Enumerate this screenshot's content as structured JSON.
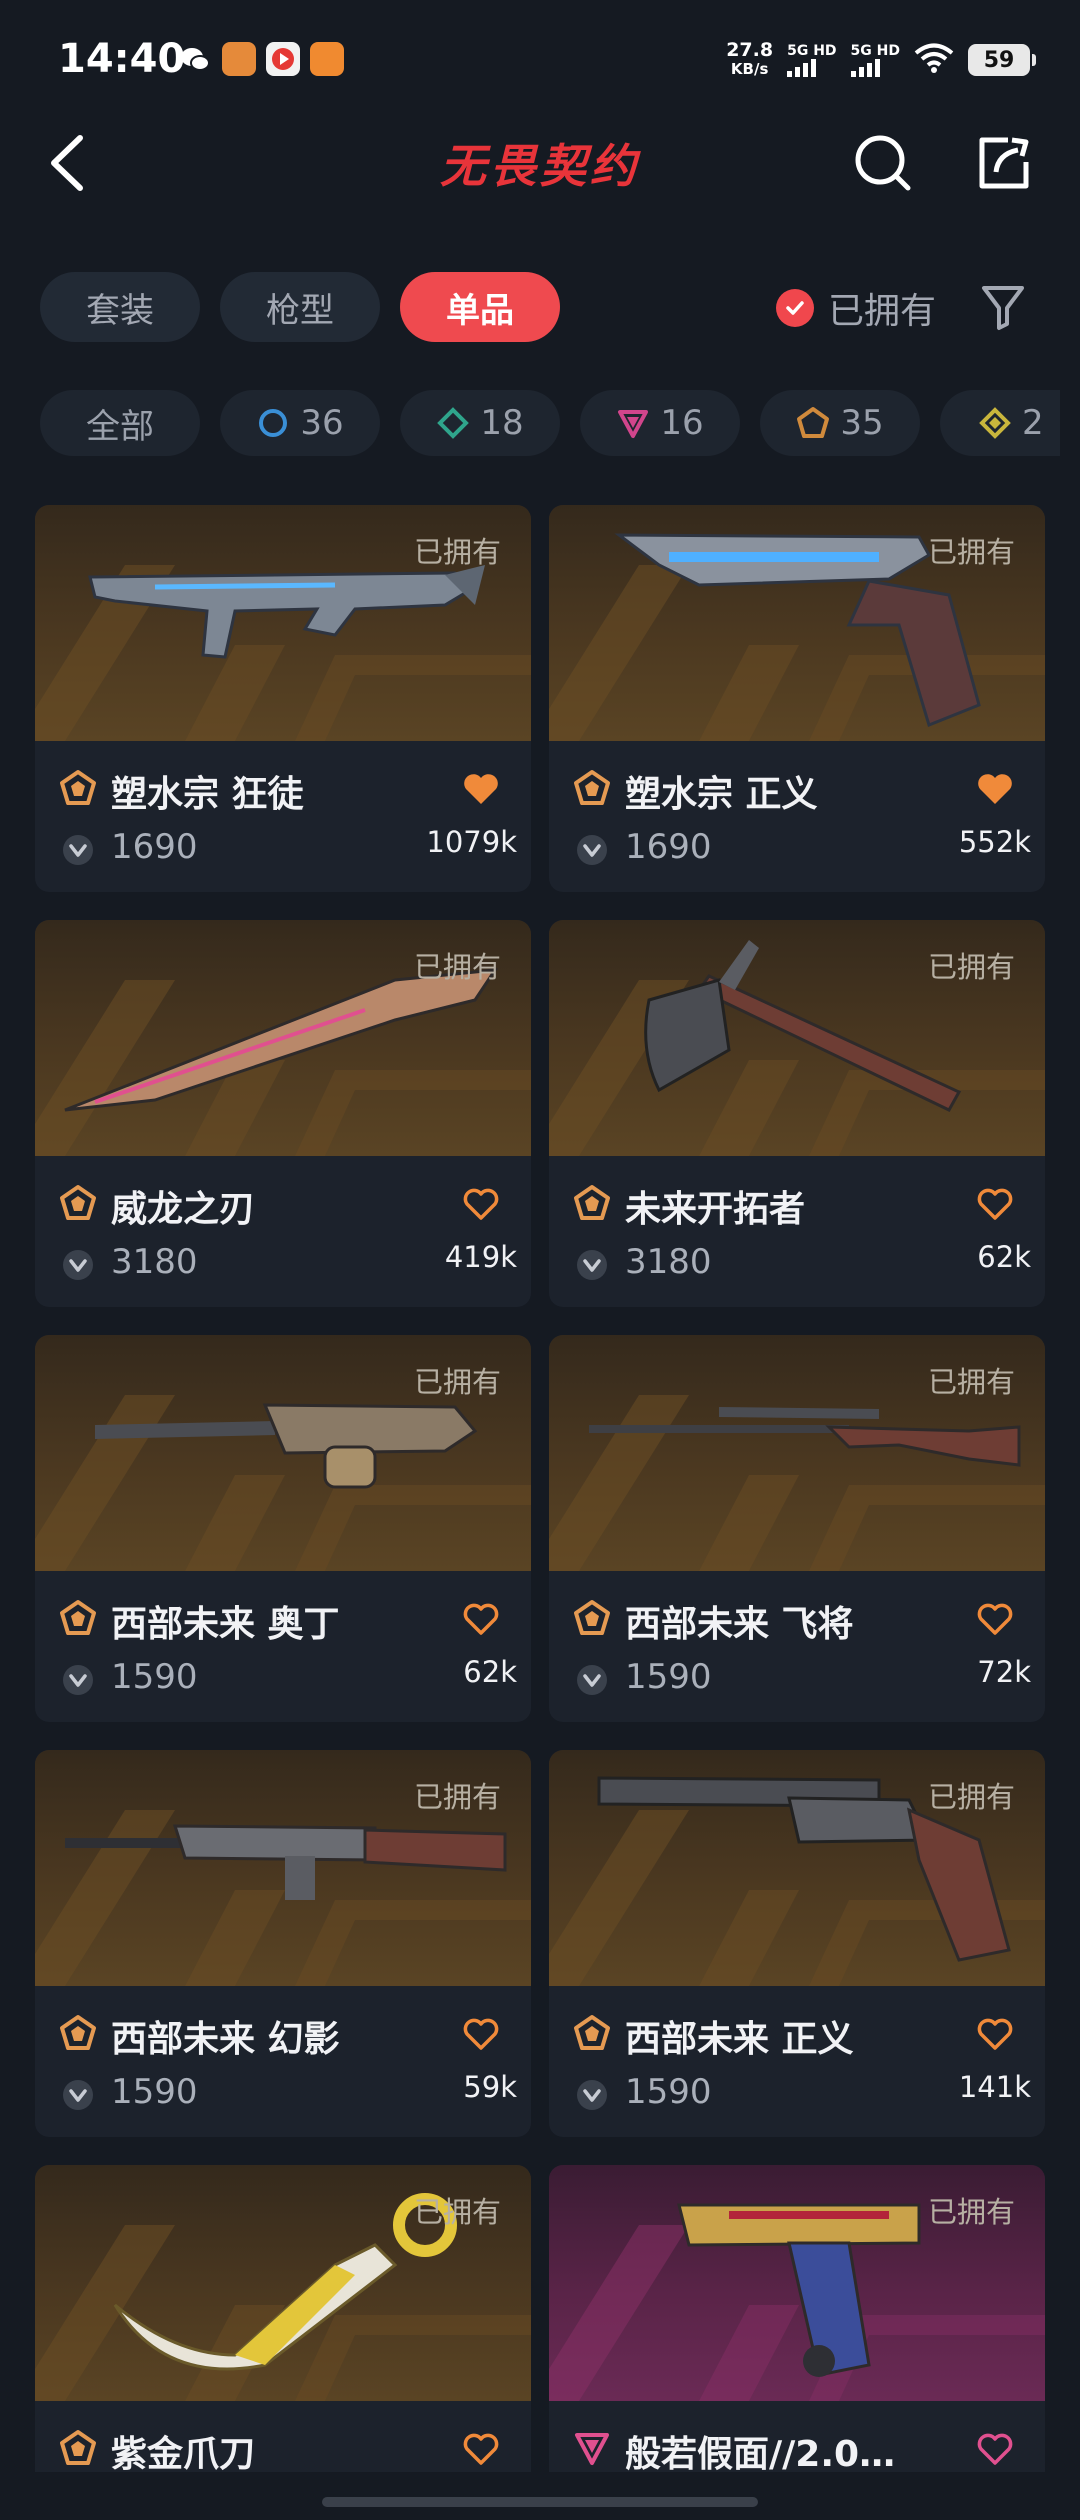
{
  "status_bar": {
    "time": "14:40",
    "net_speed_value": "27.8",
    "net_speed_unit": "KB/s",
    "signal1_label": "5G HD",
    "signal2_label": "5G HD",
    "battery": "59"
  },
  "header": {
    "title": "无畏契约"
  },
  "tabs": [
    {
      "label": "套装",
      "active": false
    },
    {
      "label": "枪型",
      "active": false
    },
    {
      "label": "单品",
      "active": true
    }
  ],
  "owned_filter": {
    "label": "已拥有",
    "checked": true
  },
  "rarity_filters": [
    {
      "label": "全部",
      "icon": "all"
    },
    {
      "label": "36",
      "icon": "select-tier-icon",
      "color": "#3a8fd6"
    },
    {
      "label": "18",
      "icon": "deluxe-tier-icon",
      "color": "#2fa58c"
    },
    {
      "label": "16",
      "icon": "premium-tier-icon",
      "color": "#d1458c"
    },
    {
      "label": "35",
      "icon": "exclusive-tier-icon",
      "color": "#d08a3c"
    },
    {
      "label": "2",
      "icon": "ultra-tier-icon",
      "color": "#c9b63c"
    }
  ],
  "items": [
    {
      "owned_label": "已拥有",
      "name": "塑水宗 狂徒",
      "price": "1690",
      "likes": "1079k",
      "favorited": true,
      "tier_color": "#e59a52",
      "bg": "gold"
    },
    {
      "owned_label": "已拥有",
      "name": "塑水宗 正义",
      "price": "1690",
      "likes": "552k",
      "favorited": true,
      "tier_color": "#e59a52",
      "bg": "gold"
    },
    {
      "owned_label": "已拥有",
      "name": "威龙之刃",
      "price": "3180",
      "likes": "419k",
      "favorited": false,
      "tier_color": "#e59a52",
      "bg": "gold"
    },
    {
      "owned_label": "已拥有",
      "name": "未来开拓者",
      "price": "3180",
      "likes": "62k",
      "favorited": false,
      "tier_color": "#e59a52",
      "bg": "gold"
    },
    {
      "owned_label": "已拥有",
      "name": "西部未来 奥丁",
      "price": "1590",
      "likes": "62k",
      "favorited": false,
      "tier_color": "#e59a52",
      "bg": "gold"
    },
    {
      "owned_label": "已拥有",
      "name": "西部未来 飞将",
      "price": "1590",
      "likes": "72k",
      "favorited": false,
      "tier_color": "#e59a52",
      "bg": "gold"
    },
    {
      "owned_label": "已拥有",
      "name": "西部未来 幻影",
      "price": "1590",
      "likes": "59k",
      "favorited": false,
      "tier_color": "#e59a52",
      "bg": "gold"
    },
    {
      "owned_label": "已拥有",
      "name": "西部未来 正义",
      "price": "1590",
      "likes": "141k",
      "favorited": false,
      "tier_color": "#e59a52",
      "bg": "gold"
    },
    {
      "owned_label": "已拥有",
      "name": "紫金爪刀",
      "price": "",
      "likes": "",
      "favorited": false,
      "tier_color": "#e59a52",
      "bg": "gold"
    },
    {
      "owned_label": "已拥有",
      "name": "般若假面//2.0…",
      "price": "",
      "likes": "",
      "favorited": false,
      "tier_color": "#e0508f",
      "bg": "purple"
    }
  ],
  "colors": {
    "accent_red": "#ef4a4f",
    "heart_orange": "#f08a3a",
    "background": "#151a22",
    "card": "#1c222c"
  }
}
